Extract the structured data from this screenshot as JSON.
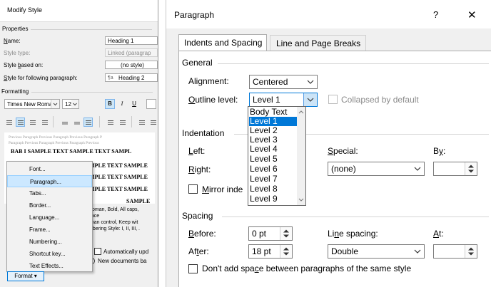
{
  "left_panel": {
    "title": "Modify Style",
    "properties_header": "Properties",
    "name_label": "Name:",
    "name_value": "Heading 1",
    "style_type_label": "Style type:",
    "style_type_value": "Linked (paragrap",
    "style_based_label": "Style based on:",
    "style_based_value": "(no style)",
    "following_label": "Style for following paragraph:",
    "following_value": "Heading 2",
    "formatting_header": "Formatting",
    "font_name": "Times New Roman",
    "font_size": "12",
    "bold_glyph": "B",
    "italic_glyph": "I",
    "underline_glyph": "U",
    "preview_prev_1": "Previous Paragraph Previous Paragraph Previous Paragraph P",
    "preview_prev_2": "Paragraph Previous Paragraph Previous Paragraph Previous",
    "preview_bold_1": "BAB I SAMPLE TEXT SAMPLE TEXT SAMPL",
    "preview_bold_2": "MPLE TEXT SAMPLE",
    "preview_bold_3": "MPLE TEXT SAMPLE",
    "preview_bold_4": "MPLE TEXT SAMPLE",
    "preview_bold_5": "SAMPLE",
    "desc_1": "Roman, Bold, All caps,",
    "desc_2": "pace",
    "desc_3": "ohan control, Keep wit",
    "desc_4": "mbering Style: I, II, III, .",
    "auto_update": "Automatically upd",
    "new_docs": "New documents ba",
    "format_button": "Format ▾",
    "menu": [
      {
        "label": "Font..."
      },
      {
        "label": "Paragraph..."
      },
      {
        "label": "Tabs..."
      },
      {
        "label": "Border..."
      },
      {
        "label": "Language..."
      },
      {
        "label": "Frame..."
      },
      {
        "label": "Numbering..."
      },
      {
        "label": "Shortcut key..."
      },
      {
        "label": "Text Effects..."
      }
    ]
  },
  "dialog": {
    "title": "Paragraph",
    "help": "?",
    "close": "✕",
    "tabs": [
      "Indents and Spacing",
      "Line and Page Breaks"
    ],
    "general_header": "General",
    "alignment_label": "Alignment:",
    "alignment_value": "Centered",
    "outline_label": "Outline level:",
    "outline_value": "Level 1",
    "collapsed_label": "Collapsed by default",
    "outline_options": [
      "Body Text",
      "Level 1",
      "Level 2",
      "Level 3",
      "Level 4",
      "Level 5",
      "Level 6",
      "Level 7",
      "Level 8",
      "Level 9"
    ],
    "outline_selected": "Level 1",
    "indentation_header": "Indentation",
    "left_label": "Left:",
    "right_label": "Right:",
    "mirror_label": "Mirror inde",
    "special_label": "Special:",
    "special_value": "(none)",
    "by_label": "By:",
    "spacing_header": "Spacing",
    "before_label": "Before:",
    "before_value": "0 pt",
    "after_label": "After:",
    "after_value": "18 pt",
    "line_spacing_label": "Line spacing:",
    "line_spacing_value": "Double",
    "at_label": "At:",
    "dont_add_label": "Don't add space between paragraphs of the same style"
  },
  "colors": {
    "accent": "#0078d7",
    "menu_highlight": "#cce8ff",
    "dialog_bg": "#f0f0f0"
  }
}
